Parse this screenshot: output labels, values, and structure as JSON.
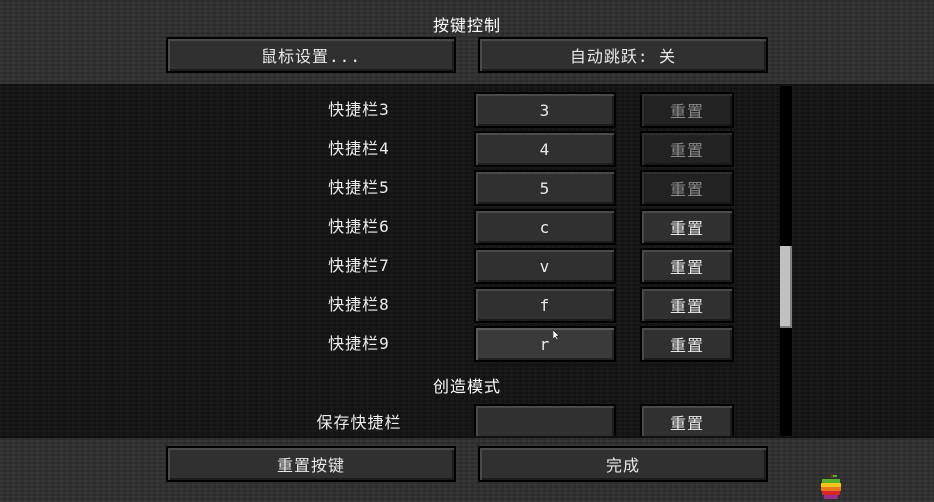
{
  "header": {
    "title": "按键控制",
    "mouse_settings_label": "鼠标设置...",
    "auto_jump_label": "自动跳跃: 关"
  },
  "keybinds": [
    {
      "label": "快捷栏3",
      "key": "3",
      "reset_label": "重置",
      "reset_enabled": false
    },
    {
      "label": "快捷栏4",
      "key": "4",
      "reset_label": "重置",
      "reset_enabled": false
    },
    {
      "label": "快捷栏5",
      "key": "5",
      "reset_label": "重置",
      "reset_enabled": false
    },
    {
      "label": "快捷栏6",
      "key": "c",
      "reset_label": "重置",
      "reset_enabled": true
    },
    {
      "label": "快捷栏7",
      "key": "v",
      "reset_label": "重置",
      "reset_enabled": true
    },
    {
      "label": "快捷栏8",
      "key": "f",
      "reset_label": "重置",
      "reset_enabled": true
    },
    {
      "label": "快捷栏9",
      "key": "r",
      "reset_label": "重置",
      "reset_enabled": true
    }
  ],
  "category": {
    "label": "创造模式"
  },
  "creative_binds": [
    {
      "label": "保存快捷栏",
      "key": "",
      "reset_label": "重置"
    }
  ],
  "footer": {
    "reset_keys_label": "重置按键",
    "done_label": "完成"
  },
  "colors": {
    "background": "#262626",
    "list_background": "#141414",
    "button": "#303030",
    "text": "#e8e8e8",
    "disabled_text": "#8a8a8a"
  }
}
